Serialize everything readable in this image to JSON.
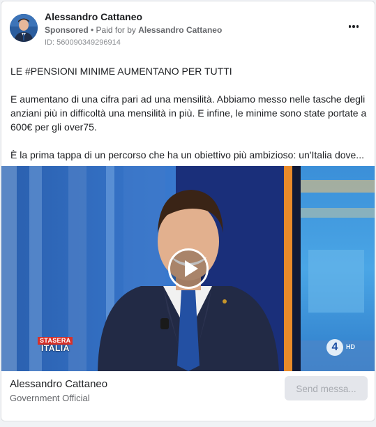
{
  "post": {
    "author": "Alessandro Cattaneo",
    "sponsored_label": "Sponsored",
    "paid_for_prefix": " • Paid for by ",
    "paid_for_name": "Alessandro Cattaneo",
    "ad_id": "ID: 560090349296914",
    "more_icon": "more-options-icon"
  },
  "content": {
    "paragraph_1": "LE #PENSIONI MINIME AUMENTANO PER TUTTI",
    "paragraph_2": "E aumentano di una cifra pari ad una mensilità. Abbiamo messo nelle tasche degli anziani più in difficoltà una mensilità in più. E infine, le minime sono state portate a 600€ per gli over75.",
    "paragraph_3": "È la prima tappa di un percorso che ha un obiettivo più ambizioso: un'Italia dove..."
  },
  "media": {
    "type": "video",
    "play_icon": "play-icon",
    "overlay_logo_top": "STASERA",
    "overlay_logo_bottom": "ITALIA",
    "channel_number": "4",
    "channel_hd": "HD"
  },
  "footer": {
    "page_name": "Alessandro Cattaneo",
    "page_category": "Government Official",
    "cta_label": "Send messa..."
  },
  "colors": {
    "background": "#f0f2f5",
    "card": "#ffffff",
    "text_primary": "#1c1e21",
    "text_secondary": "#65676b",
    "button_bg": "#e4e6eb",
    "button_text": "#a7aab0"
  }
}
